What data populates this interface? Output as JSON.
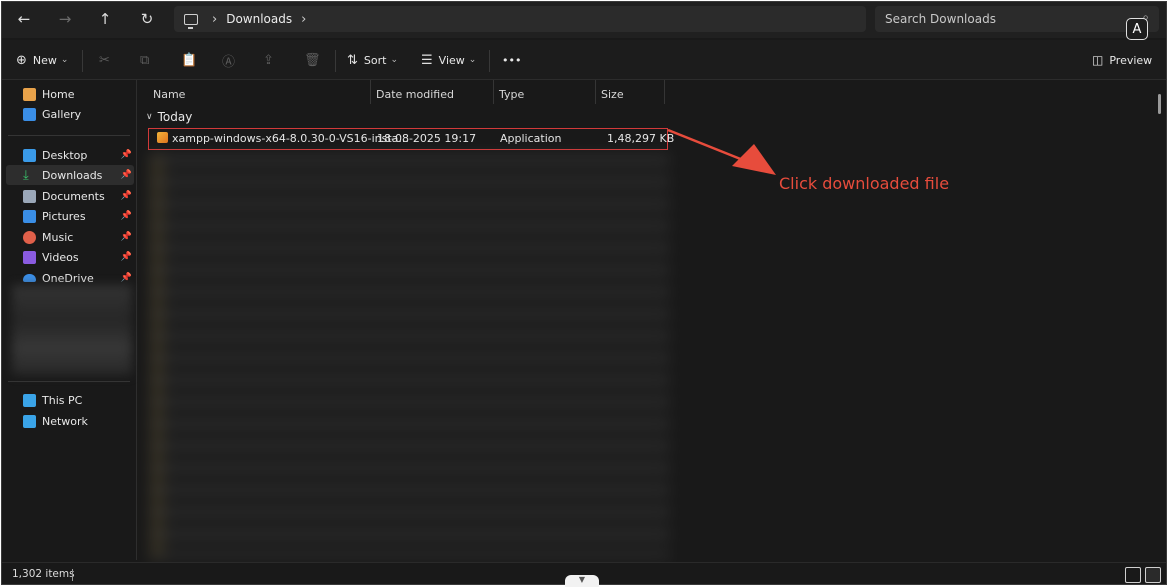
{
  "address": {
    "crumb": "Downloads"
  },
  "search": {
    "placeholder": "Search Downloads"
  },
  "a11y_badge": "A",
  "toolbar": {
    "new_label": "New",
    "sort_label": "Sort",
    "view_label": "View",
    "more_label": "•••",
    "preview_label": "Preview"
  },
  "sidebar": {
    "items": [
      {
        "label": "Home",
        "icon": "home-icon",
        "color": "#e8a24a"
      },
      {
        "label": "Gallery",
        "icon": "gallery-icon",
        "color": "#3a8ee6"
      },
      {
        "label": "Desktop",
        "icon": "desktop-icon",
        "color": "#3a9ae8"
      },
      {
        "label": "Downloads",
        "icon": "download-icon",
        "color": "#39c36b"
      },
      {
        "label": "Documents",
        "icon": "document-icon",
        "color": "#9aa7b8"
      },
      {
        "label": "Pictures",
        "icon": "pictures-icon",
        "color": "#3a8ee6"
      },
      {
        "label": "Music",
        "icon": "music-icon",
        "color": "#e0604a"
      },
      {
        "label": "Videos",
        "icon": "videos-icon",
        "color": "#8a5be0"
      },
      {
        "label": "OneDrive",
        "icon": "onedrive-icon",
        "color": "#3a8ee6"
      },
      {
        "label": "This PC",
        "icon": "pc-icon",
        "color": "#3aa4e8"
      },
      {
        "label": "Network",
        "icon": "network-icon",
        "color": "#3aa4e8"
      }
    ]
  },
  "columns": {
    "name": "Name",
    "date": "Date modified",
    "type": "Type",
    "size": "Size"
  },
  "group": {
    "label": "Today"
  },
  "file": {
    "name": "xampp-windows-x64-8.0.30-0-VS16-insta...",
    "date": "18-08-2025 19:17",
    "type": "Application",
    "size": "1,48,297 KB"
  },
  "annotation": {
    "text": "Click downloaded file",
    "color": "#e74c3c"
  },
  "status": {
    "count": "1,302 items"
  }
}
